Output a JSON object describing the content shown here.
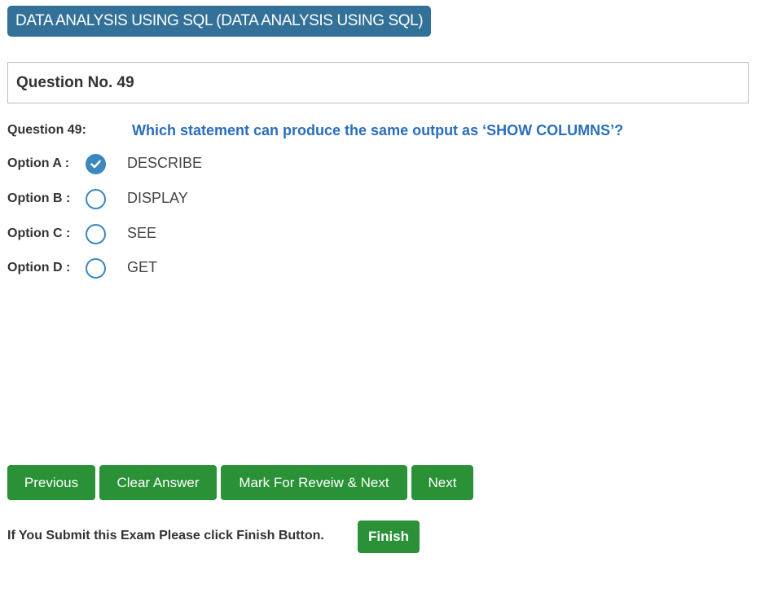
{
  "header": {
    "exam_title": "DATA ANALYSIS USING SQL (DATA ANALYSIS USING SQL)"
  },
  "question": {
    "number_heading": "Question No. 49",
    "label": "Question 49:",
    "text": "Which statement can produce the same output as ‘SHOW COLUMNS’?"
  },
  "options": [
    {
      "label": "Option A :",
      "text": "DESCRIBE",
      "selected": true
    },
    {
      "label": "Option B :",
      "text": "DISPLAY",
      "selected": false
    },
    {
      "label": "Option C :",
      "text": "SEE",
      "selected": false
    },
    {
      "label": "Option D :",
      "text": "GET",
      "selected": false
    }
  ],
  "buttons": {
    "previous": "Previous",
    "clear": "Clear Answer",
    "mark_review": "Mark For Reveiw & Next",
    "next": "Next",
    "finish": "Finish"
  },
  "footer": {
    "text": "If You Submit this Exam Please click Finish Button."
  },
  "colors": {
    "title_bg": "#337199",
    "question_text": "#2a6ebb",
    "radio": "#3a88bd",
    "button": "#2a9137"
  }
}
